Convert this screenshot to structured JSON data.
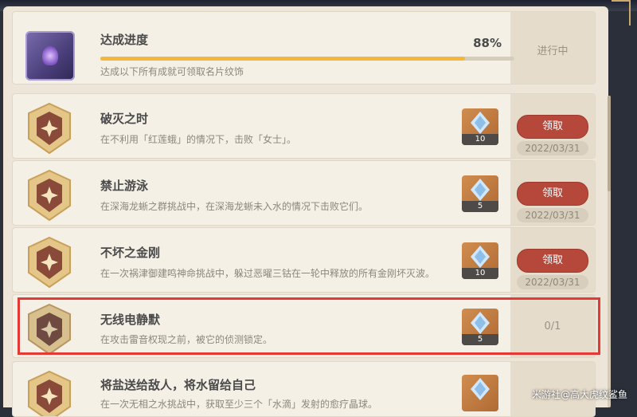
{
  "progress": {
    "title": "达成进度",
    "description": "达成以下所有成就可领取名片纹饰",
    "percent_label": "88%",
    "percent_value": 88,
    "status": "进行中",
    "icon": "namecard-preview-icon"
  },
  "achievements": [
    {
      "title": "破灭之时",
      "description": "在不利用「红莲蛾」的情况下，击败「女士」。",
      "reward_count": "10",
      "action_label": "领取",
      "date": "2022/03/31",
      "icon": "achievement-medal-icon",
      "reward_icon": "primogem-icon"
    },
    {
      "title": "禁止游泳",
      "description": "在深海龙蜥之群挑战中，在深海龙蜥未入水的情况下击败它们。",
      "reward_count": "5",
      "action_label": "领取",
      "date": "2022/03/31",
      "icon": "achievement-medal-icon",
      "reward_icon": "primogem-icon"
    },
    {
      "title": "不坏之金刚",
      "description": "在一次祸津御建鸣神命挑战中，躲过恶曜三钴在一轮中释放的所有金刚坏灭波。",
      "reward_count": "10",
      "action_label": "领取",
      "date": "2022/03/31",
      "icon": "achievement-medal-icon",
      "reward_icon": "primogem-icon"
    },
    {
      "title": "无线电静默",
      "description": "在攻击雷音权现之前，被它的侦测锁定。",
      "reward_count": "5",
      "progress_label": "0/1",
      "icon": "achievement-medal-icon",
      "reward_icon": "primogem-icon"
    },
    {
      "title": "将盐送给敌人，将水留给自己",
      "description": "在一次无相之水挑战中，获取至少三个「水滴」发射的愈疗晶球。",
      "icon": "achievement-medal-icon",
      "reward_icon": "primogem-icon"
    }
  ],
  "watermark": "米游社@高大虎纹鲨鱼",
  "colors": {
    "panel_bg": "#ece5d8",
    "card_bg": "#f5f0e6",
    "progress_fill": "#f2b73b",
    "claim_button": "#b5483a",
    "highlight_border": "#e53935"
  }
}
